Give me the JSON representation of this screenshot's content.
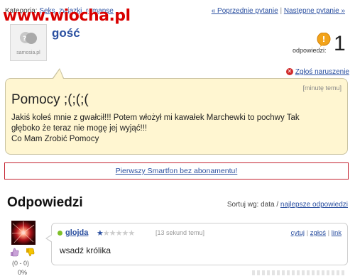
{
  "watermark": "www.wiocha.pl",
  "topbar": {
    "category_label": "Kategoria:",
    "category_link": "Seks, związki, romanse",
    "prev_question": "« Poprzednie pytanie",
    "separator": "|",
    "next_question": "Następne pytanie »"
  },
  "question_author": {
    "name": "gość",
    "avatar_brand": "samosia.pl"
  },
  "answers_counter": {
    "label": "odpowiedzi:",
    "count": "1"
  },
  "report_link": "Zgłoś naruszenie",
  "question": {
    "time": "[minutę temu]",
    "title": "Pomocy ;(;(;(",
    "body_lines": [
      "Jakiś koleś mnie z gwałcił!!! Potem włożył mi kawałek Marchewki to pochwy Tak",
      "głęboko że teraz nie mogę jej wyjąć!!!",
      "Co Mam Zrobić Pomocy"
    ]
  },
  "ad_link": "Pierwszy Smartfon bez abonamentu!",
  "answers_section": {
    "title": "Odpowiedzi",
    "sort_label": "Sortuj wg: data /",
    "sort_best": "najlepsze odpowiedzi"
  },
  "answers": [
    {
      "author": "glojda",
      "rank_stars": "★★★★★★",
      "rank_level": 1,
      "time": "[13 sekund temu]",
      "actions": {
        "quote": "cytuj",
        "sep1": "|",
        "report": "zgłoś",
        "sep2": "|",
        "link": "link"
      },
      "text": "wsadź królika",
      "votes": "(0 - 0)",
      "percent": "0%"
    }
  ],
  "colors": {
    "link": "#2a4fa0",
    "question_bg": "#fff6d1",
    "ad_border": "#c4222f",
    "online": "#7fc028",
    "watermark": "#d80000"
  }
}
